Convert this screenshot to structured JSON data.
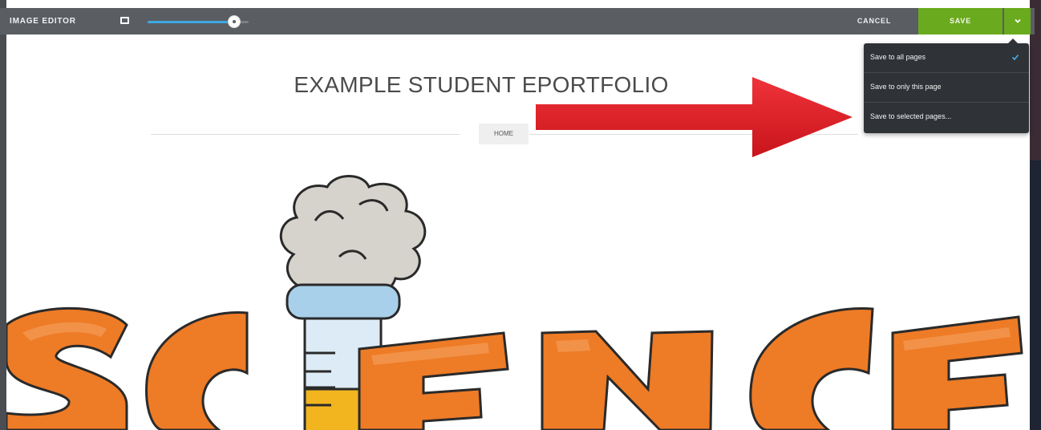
{
  "toolbar": {
    "title": "IMAGE EDITOR",
    "zoom_level_percent": 90,
    "cancel_label": "CANCEL",
    "save_label": "SAVE"
  },
  "save_menu": {
    "items": [
      {
        "label": "Save to all pages",
        "selected": true
      },
      {
        "label": "Save to only this page",
        "selected": false
      },
      {
        "label": "Save to selected pages...",
        "selected": false
      }
    ]
  },
  "site": {
    "title": "EXAMPLE STUDENT EPORTFOLIO",
    "nav": {
      "home": "HOME"
    }
  },
  "icons": {
    "frame": "frame-icon",
    "dropdown": "chevron-down-icon",
    "check": "check-icon",
    "annotation": "red-arrow"
  },
  "colors": {
    "toolbar": "#5a5e63",
    "save": "#6aaa1e",
    "menu": "#2f3338",
    "slider": "#3fa7e0",
    "arrow": "#e2262b",
    "letters": "#ee7b26"
  }
}
